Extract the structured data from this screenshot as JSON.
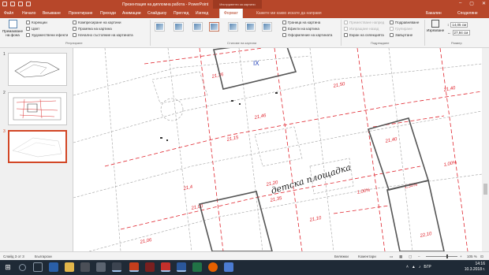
{
  "window": {
    "title": "Презентация на дипломна работа - PowerPoint",
    "context_tab": "Инструменти за картини",
    "controls": [
      "–",
      "▢",
      "✕"
    ]
  },
  "menu": {
    "tabs": [
      "Файл",
      "Начало",
      "Вмъкване",
      "Проектиране",
      "Преходи",
      "Анимации",
      "Слайдшоу",
      "Преглед",
      "Изглед",
      "Формат"
    ],
    "active_tab": "Формат",
    "tell_me": "Кажете ми какво искате да направя",
    "user": "Бакалин",
    "share": "Споделяне"
  },
  "ribbon": {
    "remove_bg": "Премахване на фона",
    "adjust": {
      "corrections": "Корекции",
      "color": "Цвят",
      "artistic": "Художествени ефекти",
      "compress": "Компресиране на картини",
      "change": "Промяна на картина",
      "reset": "Начално състояние на картината",
      "group_label": "Регулиране"
    },
    "styles": {
      "group_label": "Стилове на картини",
      "border": "Граница на картина",
      "effects": "Ефекти на картина",
      "layout": "Оформление на картината"
    },
    "arrange": {
      "bring_forward": "Преместване напред",
      "send_backward": "Изпращане назад",
      "selection_pane": "Екран на селекцията",
      "align": "Подравняване",
      "group": "Групиране",
      "rotate": "Завъртане",
      "group_label": "Подреждане"
    },
    "size": {
      "crop": "Изрязване",
      "height": "14,05 см",
      "width": "27,94 см",
      "group_label": "Размер"
    }
  },
  "slides": [
    {
      "number": "1"
    },
    {
      "number": "2"
    },
    {
      "number": "3",
      "selected": true
    }
  ],
  "canvas": {
    "label_ix": "IX",
    "label_playground": "детска площадка"
  },
  "status": {
    "slide": "Слайд 3 от 3",
    "language": "Български",
    "notes": "Бележки",
    "comments": "Коментари",
    "zoom": "105 %"
  },
  "taskbar": {
    "time": "14:16",
    "date": "10.3.2018 г.",
    "lang": "БГР"
  },
  "colors": {
    "accent": "#b7472a",
    "selection": "#d24726",
    "plan_red": "#e0262f",
    "taskbar": "#1f2a36"
  }
}
